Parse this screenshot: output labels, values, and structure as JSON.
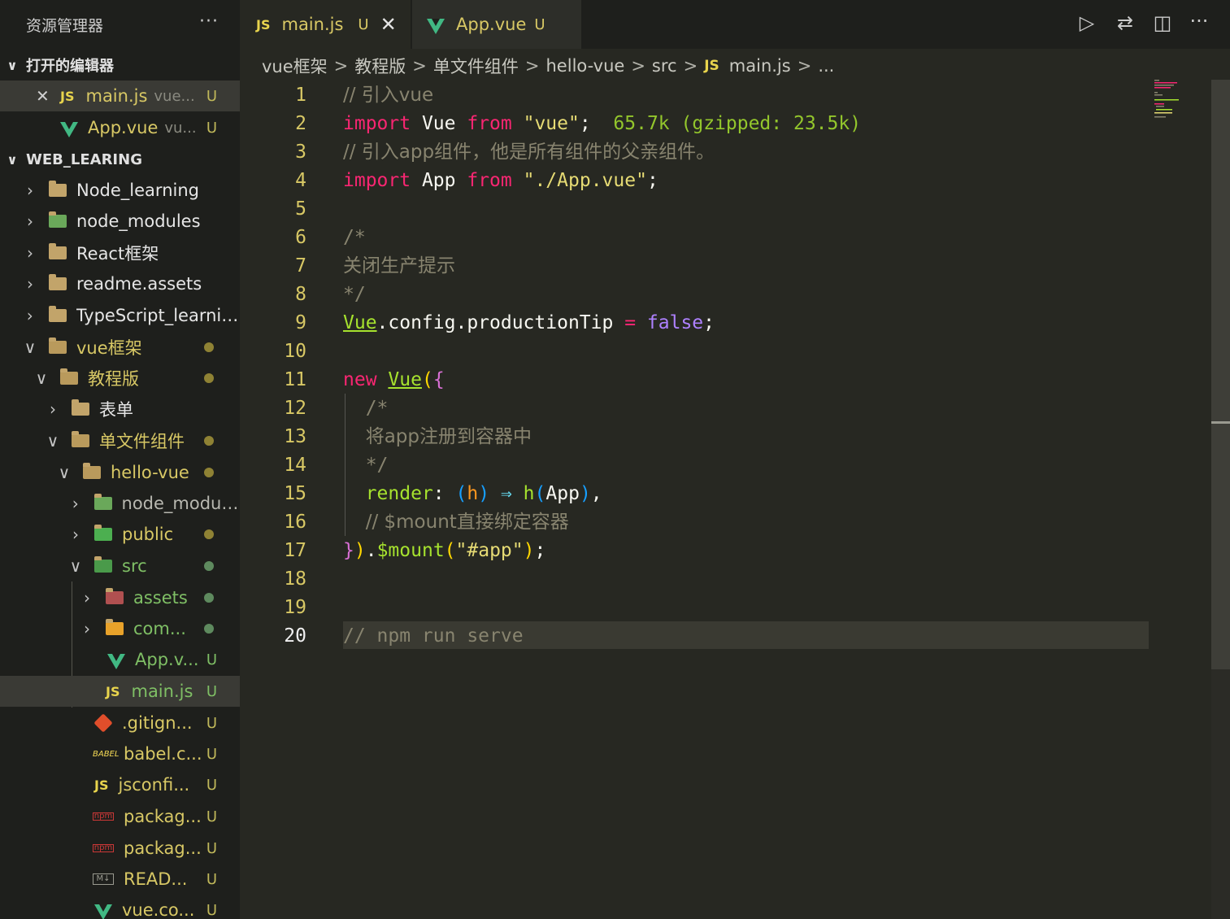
{
  "explorer": {
    "title": "资源管理器",
    "more": "···",
    "open_editors": {
      "header": "打开的编辑器",
      "items": [
        {
          "name": "main.js",
          "path": "vue...",
          "status": "U",
          "close": "✕"
        },
        {
          "name": "App.vue",
          "path": "vu...",
          "status": "U"
        }
      ]
    },
    "workspace": {
      "header": "WEB_LEARING",
      "items": [
        {
          "label": "Node_learning"
        },
        {
          "label": "node_modules"
        },
        {
          "label": "React框架"
        },
        {
          "label": "readme.assets"
        },
        {
          "label": "TypeScript_learning"
        },
        {
          "label": "vue框架"
        },
        {
          "label": "教程版"
        },
        {
          "label": "表单"
        },
        {
          "label": "单文件组件"
        },
        {
          "label": "hello-vue"
        },
        {
          "label": "node_modul..."
        },
        {
          "label": "public"
        },
        {
          "label": "src"
        },
        {
          "label": "assets"
        },
        {
          "label": "com..."
        },
        {
          "label": "App.v...",
          "status": "U"
        },
        {
          "label": "main.js",
          "status": "U"
        },
        {
          "label": ".gitign...",
          "status": "U"
        },
        {
          "label": "babel.c...",
          "status": "U"
        },
        {
          "label": "jsconfi...",
          "status": "U"
        },
        {
          "label": "packag...",
          "status": "U"
        },
        {
          "label": "packag...",
          "status": "U"
        },
        {
          "label": "READ...",
          "status": "U"
        },
        {
          "label": "vue.co...",
          "status": "U"
        }
      ]
    }
  },
  "tabs": [
    {
      "icon": "JS",
      "label": "main.js",
      "status": "U",
      "close": "✕"
    },
    {
      "label": "App.vue",
      "status": "U"
    }
  ],
  "toolbar": {
    "run": "▷",
    "compare": "⇄",
    "split": "◫",
    "more": "···"
  },
  "breadcrumb": [
    "vue框架",
    "教程版",
    "单文件组件",
    "hello-vue",
    "src",
    "main.js",
    "..."
  ],
  "breadcrumb_sep": ">",
  "editor": {
    "line_numbers": [
      "1",
      "2",
      "3",
      "4",
      "5",
      "6",
      "7",
      "8",
      "9",
      "10",
      "11",
      "12",
      "13",
      "14",
      "15",
      "16",
      "17",
      "18",
      "19",
      "20"
    ],
    "tokens": {
      "l1": "// 引入vue",
      "l2_import": "import",
      "l2_vue": "Vue",
      "l2_from": "from",
      "l2_str": "\"vue\"",
      "l2_semi": ";",
      "l2_hint": "65.7k (gzipped: 23.5k)",
      "l3": "// 引入app组件，他是所有组件的父亲组件。",
      "l4_import": "import",
      "l4_app": "App",
      "l4_from": "from",
      "l4_str": "\"./App.vue\"",
      "l4_semi": ";",
      "l6": "/*",
      "l7": "关闭生产提示",
      "l8": "*/",
      "l9_vue": "Vue",
      "l9_rest": ".config.productionTip",
      "l9_eq": "=",
      "l9_false": "false",
      "l9_semi": ";",
      "l11_new": "new",
      "l11_vue": "Vue",
      "l11_paren": "(",
      "l11_brace": "{",
      "l12": "/*",
      "l13": "将app注册到容器中",
      "l14": "*/",
      "l15_render": "render",
      "l15_colon": ":",
      "l15_lp": "(",
      "l15_h": "h",
      "l15_rp": ")",
      "l15_arrow": "⇒",
      "l15_call": "h",
      "l15_lp2": "(",
      "l15_app": "App",
      "l15_rp2": ")",
      "l15_comma": ",",
      "l16": "// $mount直接绑定容器",
      "l17_brace": "}",
      "l17_paren": ")",
      "l17_dot": ".",
      "l17_mount": "$mount",
      "l17_lp": "(",
      "l17_str": "\"#app\"",
      "l17_rp": ")",
      "l17_semi": ";",
      "l20": "// npm run serve"
    }
  }
}
